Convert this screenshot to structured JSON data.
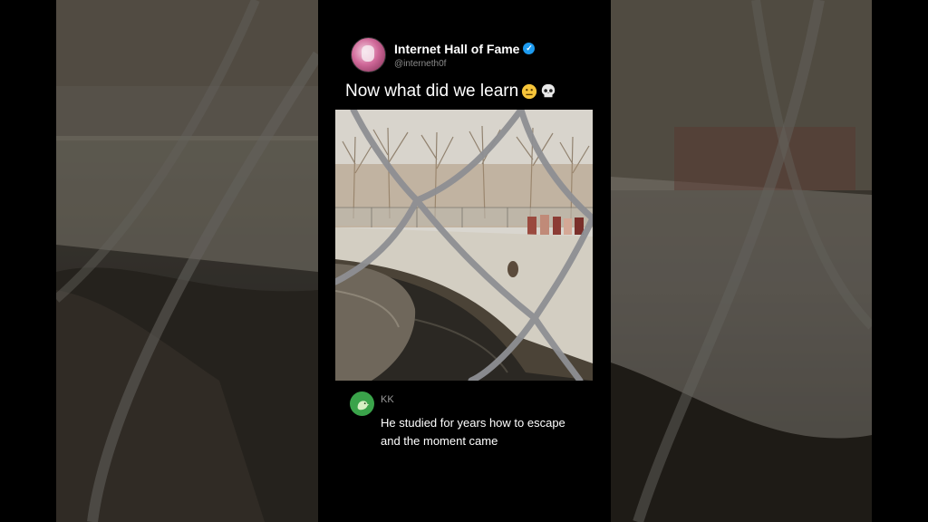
{
  "post": {
    "display_name": "Internet Hall of Fame",
    "handle": "@interneth0f",
    "verified_icon": "verified-badge-icon",
    "caption": "Now what did we learn",
    "caption_emojis": [
      "neutral-face-icon",
      "skull-icon"
    ],
    "media": {
      "description_icon": "video-frame-icon"
    }
  },
  "reply": {
    "name": "KK",
    "avatar_icon": "dinosaur-avatar-icon",
    "text_line1": "He studied for years how to escape",
    "text_line2": "and the moment came"
  },
  "colors": {
    "background": "#000000",
    "verified": "#1d9bf0",
    "handle": "#8b8b8b",
    "reply_avatar": "#3aa34a"
  }
}
